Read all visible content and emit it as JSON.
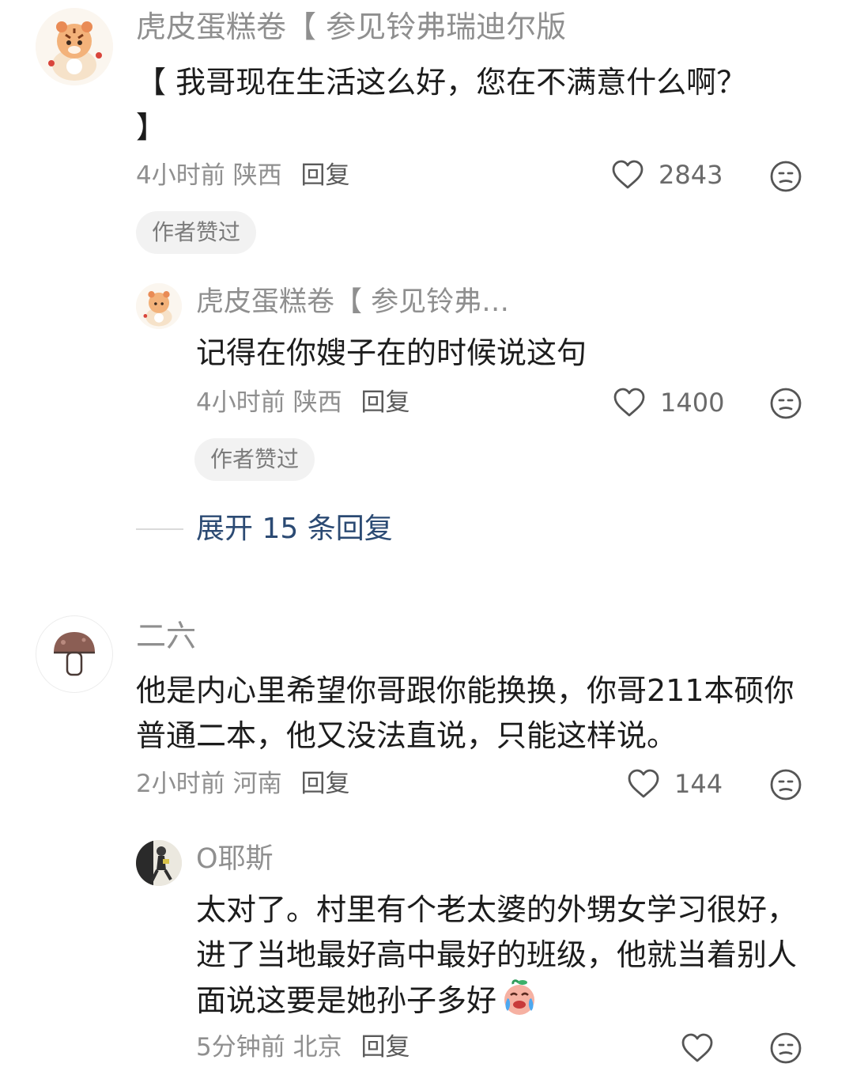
{
  "comments": [
    {
      "username": "虎皮蛋糕卷【 参见铃弗瑞迪尔版",
      "avatar_icon": "tiger-cartoon-avatar",
      "text": "【 我哥现在生活这么好，您在不满意什么啊？ 】",
      "time": "4小时前",
      "location": "陕西",
      "reply_label": "回复",
      "likes": "2843",
      "badge": "作者赞过",
      "replies": [
        {
          "username": "虎皮蛋糕卷【 参见铃弗…",
          "avatar_icon": "tiger-cartoon-avatar",
          "text": "记得在你嫂子在的时候说这句",
          "time": "4小时前",
          "location": "陕西",
          "reply_label": "回复",
          "likes": "1400",
          "badge": "作者赞过"
        }
      ],
      "expand_label": "展开 15 条回复"
    },
    {
      "username": "二六",
      "avatar_icon": "mushroom-avatar",
      "text": "他是内心里希望你哥跟你能换换，你哥211本硕你普通二本，他又没法直说，只能这样说。",
      "time": "2小时前",
      "location": "河南",
      "reply_label": "回复",
      "likes": "144",
      "replies": [
        {
          "username": "O耶斯",
          "avatar_icon": "person-photo-avatar",
          "text": "太对了。村里有个老太婆的外甥女学习很好，进了当地最好高中最好的班级，他就当着别人面说这要是她孙子多好",
          "emoji_icon": "crying-laughing-peach-emoji",
          "time": "5分钟前",
          "location": "北京",
          "reply_label": "回复",
          "likes": ""
        }
      ]
    }
  ],
  "icons": {
    "like": "heart-outline-icon",
    "dislike": "neutral-face-icon"
  },
  "colors": {
    "meta_gray": "#8f8f8f",
    "expand_link": "#2b4a73",
    "badge_bg": "#f2f2f2"
  }
}
